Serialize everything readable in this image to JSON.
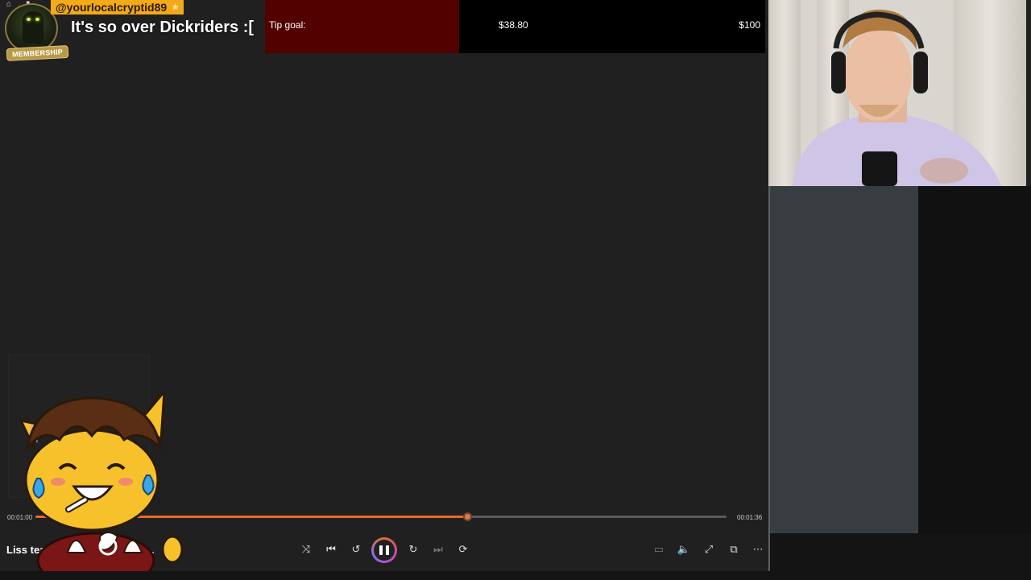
{
  "alert": {
    "username": "@yourlocalcryptid89",
    "badge": "MEMBERSHIP",
    "message": "It's so over Dickriders :["
  },
  "tip_goal": {
    "label": "Tip goal:",
    "current": "$38.80",
    "target": "$100",
    "progress_fraction": 0.388,
    "fill_color": "#520000"
  },
  "player": {
    "time_current": "00:01:00",
    "time_total": "00:01:36",
    "progress_fraction": 0.625,
    "track_title": "Liss tea... d malintent - No d...",
    "accent_color": "#e76a2a",
    "controls": {
      "shuffle": "shuffle-icon",
      "previous": "previous-icon",
      "rewind": "rewind-10-icon",
      "play_pause": "pause-icon",
      "forward": "forward-30-icon",
      "next": "next-icon",
      "repeat": "repeat-off-icon",
      "miniplayer": "miniplayer-icon",
      "volume": "volume-icon",
      "fullscreen": "fullscreen-icon",
      "popout": "popout-icon",
      "more": "more-icon"
    },
    "glyphs": {
      "shuffle": "⤨",
      "previous": "⏮",
      "rewind": "↺",
      "forward": "↻",
      "next": "⏭",
      "repeat": "⟳",
      "miniplayer": "▭",
      "volume": "🔈",
      "fullscreen": "⤢",
      "popout": "⧉",
      "more": "⋯"
    }
  }
}
